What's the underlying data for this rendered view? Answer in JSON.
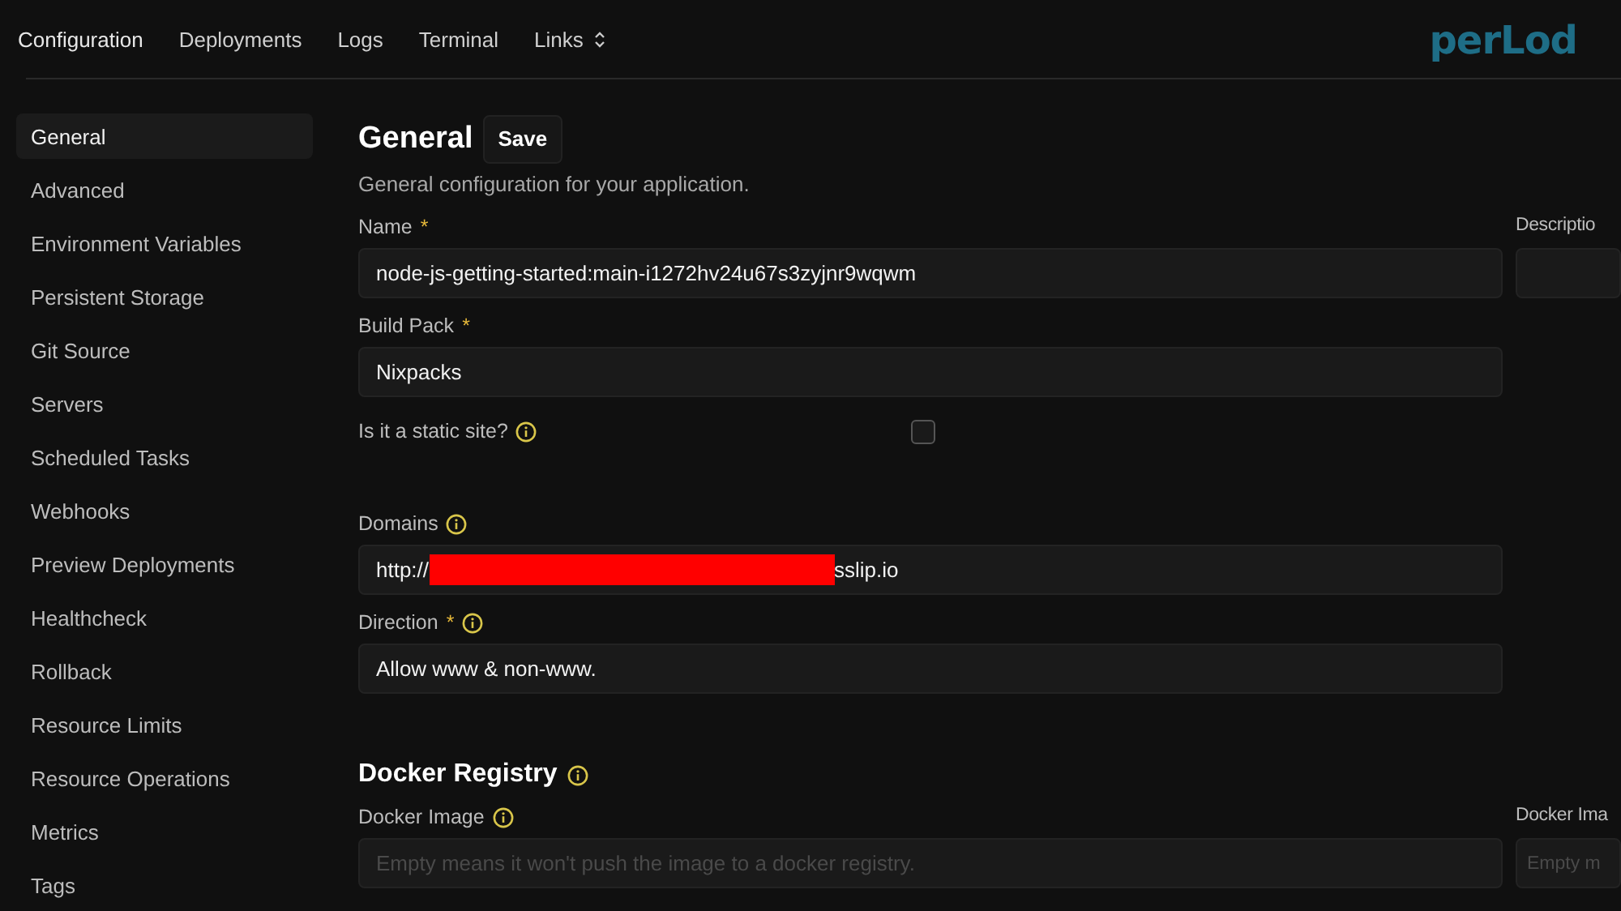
{
  "top_nav": {
    "items": [
      {
        "label": "Configuration",
        "selected": true
      },
      {
        "label": "Deployments",
        "selected": false
      },
      {
        "label": "Logs",
        "selected": false
      },
      {
        "label": "Terminal",
        "selected": false
      },
      {
        "label": "Links",
        "selected": false,
        "has_menu": true
      }
    ],
    "logo": "perLod"
  },
  "sidebar": {
    "items": [
      {
        "label": "General",
        "selected": true
      },
      {
        "label": "Advanced",
        "selected": false
      },
      {
        "label": "Environment Variables",
        "selected": false
      },
      {
        "label": "Persistent Storage",
        "selected": false
      },
      {
        "label": "Git Source",
        "selected": false
      },
      {
        "label": "Servers",
        "selected": false
      },
      {
        "label": "Scheduled Tasks",
        "selected": false
      },
      {
        "label": "Webhooks",
        "selected": false
      },
      {
        "label": "Preview Deployments",
        "selected": false
      },
      {
        "label": "Healthcheck",
        "selected": false
      },
      {
        "label": "Rollback",
        "selected": false
      },
      {
        "label": "Resource Limits",
        "selected": false
      },
      {
        "label": "Resource Operations",
        "selected": false
      },
      {
        "label": "Metrics",
        "selected": false
      },
      {
        "label": "Tags",
        "selected": false
      }
    ]
  },
  "general": {
    "title": "General",
    "save_button": "Save",
    "subtitle": "General configuration for your application.",
    "fields": [
      {
        "kind": "text",
        "label": "Name",
        "required_mark": "*",
        "value": "node-js-getting-started:main-i1272hv24u67s3zyjnr9wqwm"
      },
      {
        "kind": "text",
        "label": "Build Pack",
        "required_mark": "*",
        "value": "Nixpacks"
      },
      {
        "kind": "checkbox",
        "label": "Is it a static site?",
        "info": true,
        "checked": false
      },
      {
        "kind": "spacer"
      },
      {
        "kind": "redacted",
        "label": "Domains",
        "info": true,
        "value_start": "http://",
        "value_end": "sslip.io"
      },
      {
        "kind": "text",
        "label": "Direction",
        "required_mark": "*",
        "info": true,
        "value": "Allow www & non-www."
      }
    ],
    "side_fields": [
      {
        "label": "Descriptio"
      }
    ]
  },
  "docker_registry": {
    "title": "Docker Registry",
    "info": true,
    "fields": [
      {
        "label": "Docker Image",
        "info": true,
        "placeholder": "Empty means it won't push the image to a docker registry."
      }
    ],
    "side_fields": [
      {
        "label": "Docker Ima",
        "placeholder": "Empty m"
      }
    ]
  }
}
